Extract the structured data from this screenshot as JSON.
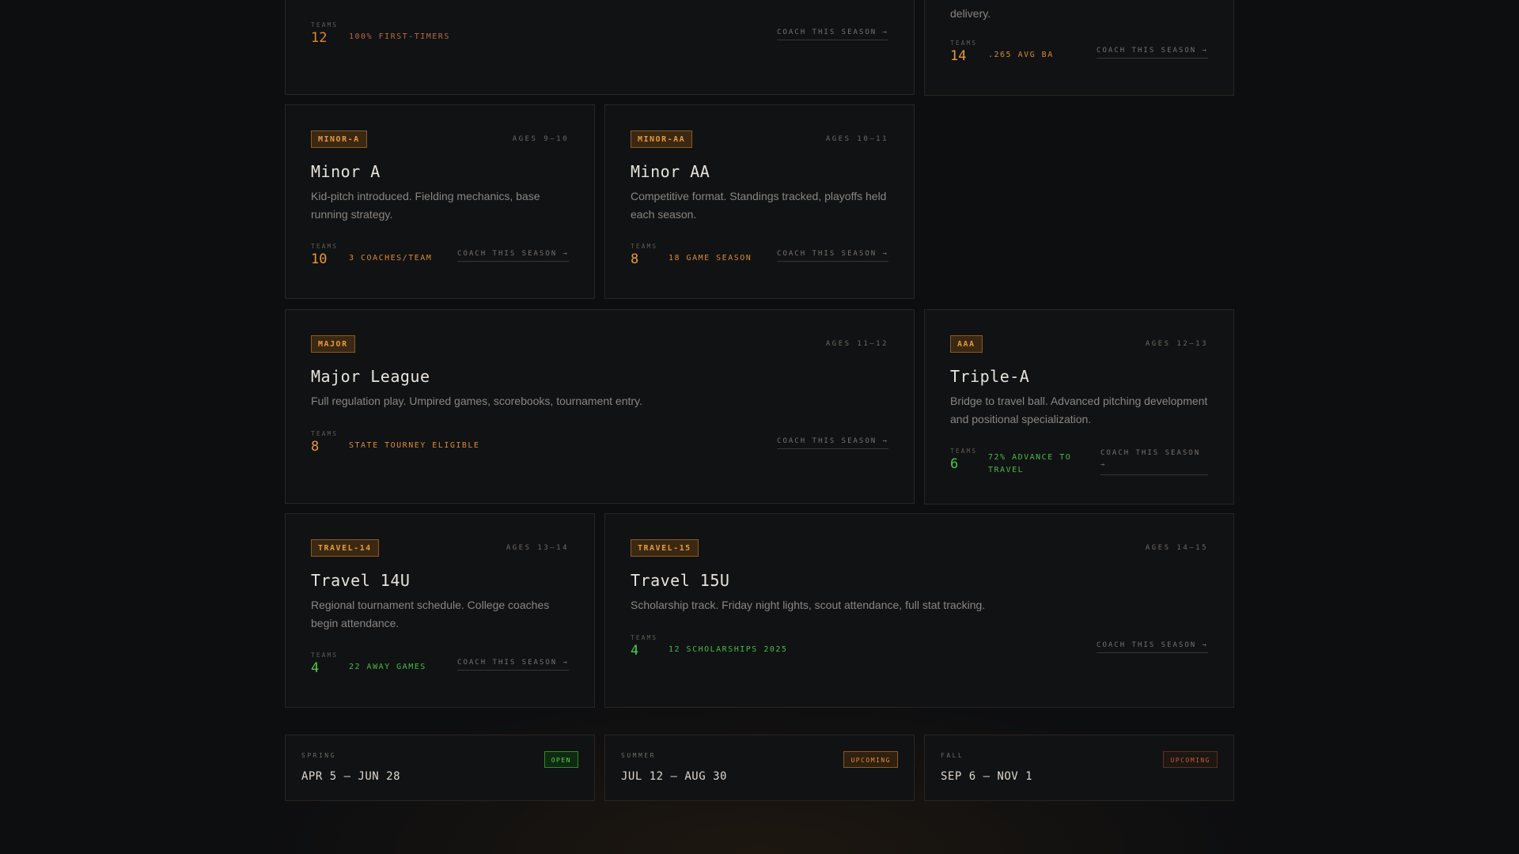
{
  "cards": {
    "top_left": {
      "teams_label": "TEAMS",
      "teams": "12",
      "note": "100% FIRST-TIMERS",
      "cta": "COACH THIS SEASON →"
    },
    "top_right": {
      "desc_tail": "delivery.",
      "teams_label": "TEAMS",
      "teams": "14",
      "note": ".265 AVG BA",
      "cta": "COACH THIS SEASON →"
    },
    "minor_a": {
      "badge": "MINOR-A",
      "ages": "AGES 9–10",
      "title": "Minor A",
      "desc": "Kid-pitch introduced. Fielding mechanics, base running strategy.",
      "teams_label": "TEAMS",
      "teams": "10",
      "note": "3 COACHES/TEAM",
      "cta": "COACH THIS SEASON →"
    },
    "minor_aa": {
      "badge": "MINOR-AA",
      "ages": "AGES 10–11",
      "title": "Minor AA",
      "desc": "Competitive format. Standings tracked, playoffs held each season.",
      "teams_label": "TEAMS",
      "teams": "8",
      "note": "18 GAME SEASON",
      "cta": "COACH THIS SEASON →"
    },
    "major": {
      "badge": "MAJOR",
      "ages": "AGES 11–12",
      "title": "Major League",
      "desc": "Full regulation play. Umpired games, scorebooks, tournament entry.",
      "teams_label": "TEAMS",
      "teams": "8",
      "note": "STATE TOURNEY ELIGIBLE",
      "cta": "COACH THIS SEASON →"
    },
    "aaa": {
      "badge": "AAA",
      "ages": "AGES 12–13",
      "title": "Triple-A",
      "desc": "Bridge to travel ball. Advanced pitching development and positional specialization.",
      "teams_label": "TEAMS",
      "teams": "6",
      "note": "72% ADVANCE TO TRAVEL",
      "cta": "COACH THIS SEASON →"
    },
    "travel14": {
      "badge": "TRAVEL-14",
      "ages": "AGES 13–14",
      "title": "Travel 14U",
      "desc": "Regional tournament schedule. College coaches begin attendance.",
      "teams_label": "TEAMS",
      "teams": "4",
      "note": "22 AWAY GAMES",
      "cta": "COACH THIS SEASON →"
    },
    "travel15": {
      "badge": "TRAVEL-15",
      "ages": "AGES 14–15",
      "title": "Travel 15U",
      "desc": "Scholarship track. Friday night lights, scout attendance, full stat tracking.",
      "teams_label": "TEAMS",
      "teams": "4",
      "note": "12 SCHOLARSHIPS 2025",
      "cta": "COACH THIS SEASON →"
    }
  },
  "seasons": [
    {
      "label": "SPRING",
      "dates": "APR 5 – JUN 28",
      "status": "OPEN"
    },
    {
      "label": "SUMMER",
      "dates": "JUL 12 – AUG 30",
      "status": "UPCOMING"
    },
    {
      "label": "FALL",
      "dates": "SEP 6 – NOV 1",
      "status": "UPCOMING"
    }
  ],
  "colors": {
    "background": "#0d0e10",
    "card": "#111214",
    "accent_orange": "#e79a3e",
    "accent_green": "#4cc94c"
  }
}
